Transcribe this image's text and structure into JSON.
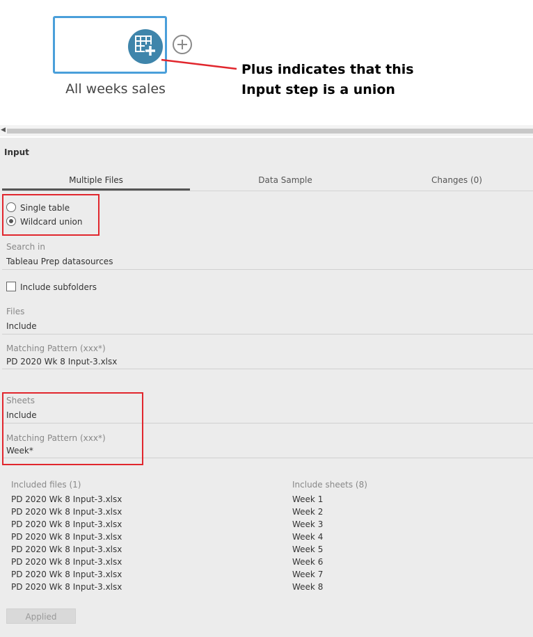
{
  "flow": {
    "node_label": "All weeks sales",
    "annotation_line1": "Plus indicates that this",
    "annotation_line2": "Input step is a union",
    "node_color": "#3f85ab",
    "node_border_color": "#4a9fda",
    "annotation_color": "#e1262d",
    "node_icon": "table-plus-icon",
    "add_icon": "plus-circle-icon"
  },
  "panel": {
    "title": "Input",
    "tabs": [
      {
        "label": "Multiple Files",
        "active": true
      },
      {
        "label": "Data Sample",
        "active": false
      },
      {
        "label": "Changes (0)",
        "active": false
      }
    ],
    "connection_options": {
      "single_table": "Single table",
      "wildcard_union": "Wildcard union",
      "selected": "Wildcard union"
    },
    "search_in": {
      "label": "Search in",
      "value": "Tableau Prep datasources"
    },
    "include_subfolders": {
      "label": "Include subfolders",
      "checked": false
    },
    "files": {
      "label": "Files",
      "value": "Include",
      "pattern_label": "Matching Pattern (xxx*)",
      "pattern_value": "PD 2020 Wk 8 Input-3.xlsx"
    },
    "sheets": {
      "label": "Sheets",
      "value": "Include",
      "pattern_label": "Matching Pattern (xxx*)",
      "pattern_value": "Week*"
    },
    "included_files": {
      "header": "Included files (1)",
      "items": [
        "PD 2020 Wk 8 Input-3.xlsx",
        "PD 2020 Wk 8 Input-3.xlsx",
        "PD 2020 Wk 8 Input-3.xlsx",
        "PD 2020 Wk 8 Input-3.xlsx",
        "PD 2020 Wk 8 Input-3.xlsx",
        "PD 2020 Wk 8 Input-3.xlsx",
        "PD 2020 Wk 8 Input-3.xlsx",
        "PD 2020 Wk 8 Input-3.xlsx"
      ]
    },
    "included_sheets": {
      "header": "Include sheets (8)",
      "items": [
        "Week 1",
        "Week 2",
        "Week 3",
        "Week 4",
        "Week 5",
        "Week 6",
        "Week 7",
        "Week 8"
      ]
    },
    "applied_button": "Applied",
    "highlight_color": "#e1262d"
  }
}
